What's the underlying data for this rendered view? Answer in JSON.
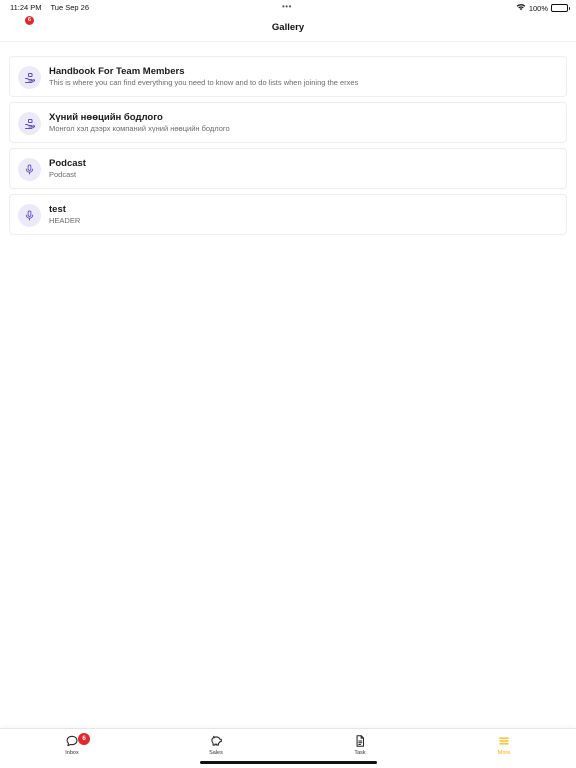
{
  "status_bar": {
    "time": "11:24 PM",
    "date": "Tue Sep 26",
    "dots": "•••",
    "battery_text": "100%",
    "wifi_icon": "wifi-icon",
    "battery_icon": "battery-icon"
  },
  "header": {
    "badge": "6",
    "title": "Gallery"
  },
  "gallery": {
    "items": [
      {
        "title": "Handbook For Team Members",
        "subtitle": "This is where you can find everything you need to know and to do lists when joining the erxes",
        "icon": "hand-giving-icon"
      },
      {
        "title": "Хүний нөөцийн бодлого",
        "subtitle": "Монгол хэл дээрх компаний хүний нөөцийн бодлого",
        "icon": "hand-giving-icon"
      },
      {
        "title": "Podcast",
        "subtitle": "Podcast",
        "icon": "microphone-icon"
      },
      {
        "title": "test",
        "subtitle": "HEADER",
        "icon": "microphone-icon"
      }
    ]
  },
  "tab_bar": {
    "tabs": [
      {
        "label": "Inbox",
        "icon": "chat-bubble-icon",
        "badge": "6",
        "active": false
      },
      {
        "label": "Sales",
        "icon": "piggy-bank-icon",
        "active": false
      },
      {
        "label": "Task",
        "icon": "document-icon",
        "active": false
      },
      {
        "label": "More",
        "icon": "menu-icon",
        "active": true
      }
    ]
  },
  "colors": {
    "accent": "#f5b400",
    "icon_purple": "#5b4fc4",
    "icon_bg": "#eceaf8",
    "badge_red": "#e0282e"
  }
}
